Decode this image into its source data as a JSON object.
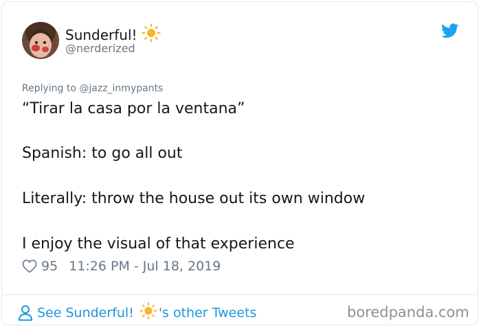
{
  "author": {
    "display_name": "Sunderful!",
    "handle": "@nerderized"
  },
  "tweet": {
    "replying_to": "Replying to @jazz_inmypants",
    "lines": [
      "“Tirar la casa por la ventana”",
      "Spanish: to go all out",
      "Literally: throw the house out its own window",
      "I enjoy the visual of that experience"
    ],
    "likes": "95",
    "timestamp": "11:26 PM - Jul 18, 2019"
  },
  "footer": {
    "see_prefix": "See Sunderful!",
    "see_suffix": "'s other Tweets",
    "watermark": "boredpanda.com"
  },
  "colors": {
    "link": "#1b95e0",
    "muted": "#657786",
    "text": "#14171a",
    "sun": "#f7b52c"
  },
  "icons": [
    "avatar",
    "sun-icon",
    "twitter-bird-icon",
    "heart-icon",
    "person-icon"
  ]
}
